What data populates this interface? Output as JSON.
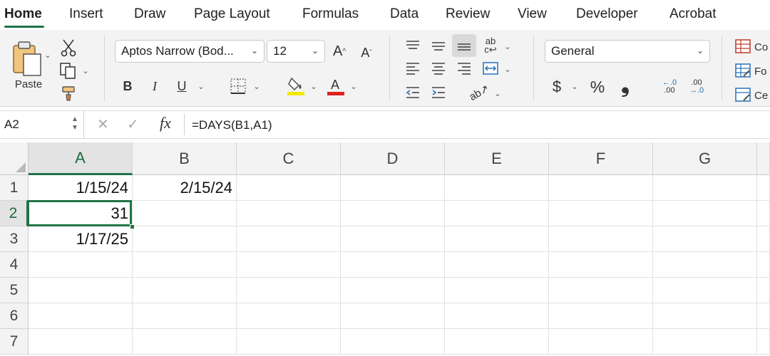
{
  "tabs": [
    {
      "label": "Home",
      "active": true
    },
    {
      "label": "Insert"
    },
    {
      "label": "Draw"
    },
    {
      "label": "Page Layout"
    },
    {
      "label": "Formulas"
    },
    {
      "label": "Data"
    },
    {
      "label": "Review"
    },
    {
      "label": "View"
    },
    {
      "label": "Developer"
    },
    {
      "label": "Acrobat"
    }
  ],
  "ribbon": {
    "paste_label": "Paste",
    "font_name": "Aptos Narrow (Bod...",
    "font_size": "12",
    "bold": "B",
    "italic": "I",
    "underline": "U",
    "number_format": "General",
    "currency": "$",
    "percent": "%",
    "comma": "❟",
    "styles_items": [
      "Co",
      "Fo",
      "Ce"
    ],
    "colors": {
      "highlight": "#f5e800",
      "font_color": "#e02020",
      "accent": "#217346"
    }
  },
  "formula_bar": {
    "name_box": "A2",
    "fx_label": "fx",
    "formula": "=DAYS(B1,A1)"
  },
  "grid": {
    "columns": [
      "A",
      "B",
      "C",
      "D",
      "E",
      "F",
      "G"
    ],
    "rows": [
      "1",
      "2",
      "3",
      "4",
      "5",
      "6",
      "7"
    ],
    "cells": {
      "A1": "1/15/24",
      "B1": "2/15/24",
      "A2": "31",
      "A3": "1/17/25"
    },
    "active_cell": "A2"
  }
}
